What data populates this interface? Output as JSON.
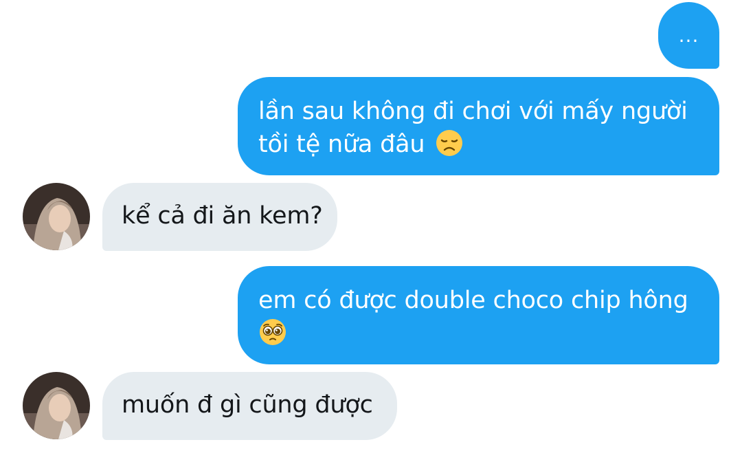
{
  "messages": [
    {
      "direction": "sent",
      "text": "..."
    },
    {
      "direction": "sent",
      "text": "lần sau không đi chơi với mấy người",
      "text_line2": "tồi tệ nữa đâu",
      "emoji": "disappointed-face-emoji"
    },
    {
      "direction": "received",
      "text": "kể cả đi ăn kem?",
      "avatar": "user-avatar"
    },
    {
      "direction": "sent",
      "text": "em có được double choco chip hông",
      "emoji": "pleading-face-emoji"
    },
    {
      "direction": "received",
      "text": "muốn đ gì cũng được",
      "avatar": "user-avatar"
    }
  ],
  "colors": {
    "sent_bubble": "#1da1f2",
    "received_bubble": "#e6ecf0",
    "sent_text": "#ffffff",
    "received_text": "#14171a"
  }
}
